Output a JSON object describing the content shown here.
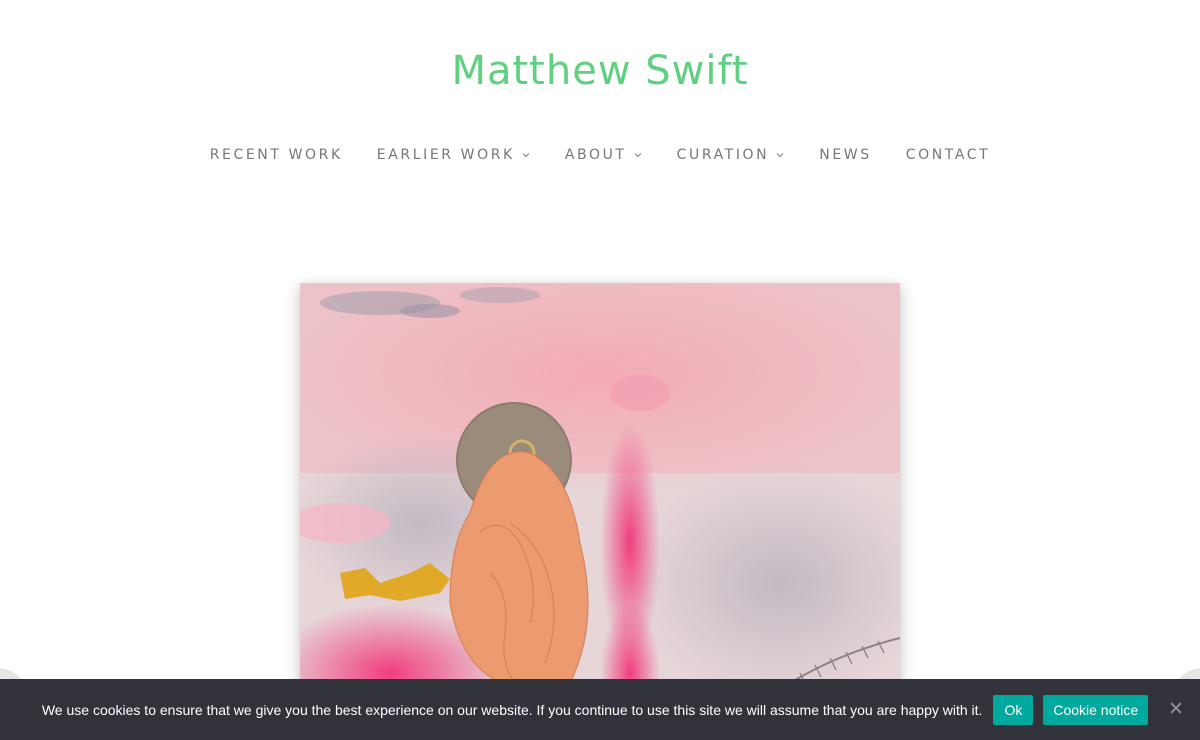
{
  "site": {
    "title": "Matthew Swift",
    "title_color": "#5fcf80"
  },
  "nav": {
    "items": [
      {
        "label": "RECENT WORK",
        "has_dropdown": false
      },
      {
        "label": "EARLIER WORK",
        "has_dropdown": true
      },
      {
        "label": "ABOUT",
        "has_dropdown": true
      },
      {
        "label": "CURATION",
        "has_dropdown": true
      },
      {
        "label": "NEWS",
        "has_dropdown": false
      },
      {
        "label": "CONTACT",
        "has_dropdown": false
      }
    ]
  },
  "gallery": {
    "prev_icon": "chevron-left-icon",
    "next_icon": "chevron-right-icon"
  },
  "cookie": {
    "message": "We use cookies to ensure that we give you the best experience on our website. If you continue to use this site we will assume that you are happy with it.",
    "ok_label": "Ok",
    "notice_label": "Cookie notice",
    "button_color": "#00a99d",
    "bar_color": "#32323a"
  }
}
